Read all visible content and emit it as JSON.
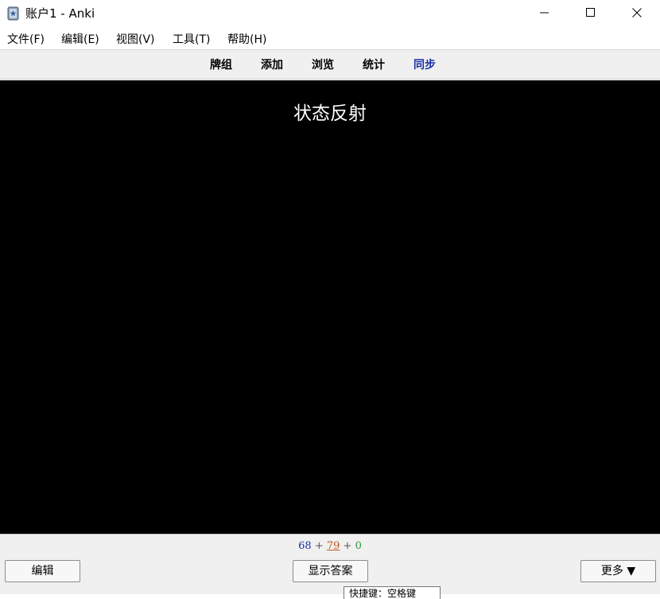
{
  "window": {
    "title": "账户1 - Anki",
    "icon": "anki-icon",
    "minimize_icon": "minimize-icon",
    "maximize_icon": "maximize-icon",
    "close_icon": "close-icon"
  },
  "menubar": {
    "items": [
      "文件(F)",
      "编辑(E)",
      "视图(V)",
      "工具(T)",
      "帮助(H)"
    ]
  },
  "toolbar": {
    "items": [
      {
        "label": "牌组",
        "active": false
      },
      {
        "label": "添加",
        "active": false
      },
      {
        "label": "浏览",
        "active": false
      },
      {
        "label": "统计",
        "active": false
      },
      {
        "label": "同步",
        "active": true
      }
    ]
  },
  "card": {
    "question": "状态反射",
    "background": "#000000",
    "text_color": "#ffffff"
  },
  "counts": {
    "new": "68",
    "learn": "79",
    "review": "0",
    "separator": "+",
    "new_color": "#1a2fa6",
    "learn_color": "#c3541b",
    "review_color": "#2b9a3a"
  },
  "bottom": {
    "edit_label": "编辑",
    "show_answer_label": "显示答案",
    "more_label": "更多 ▼",
    "tooltip": "快捷键：空格键"
  }
}
